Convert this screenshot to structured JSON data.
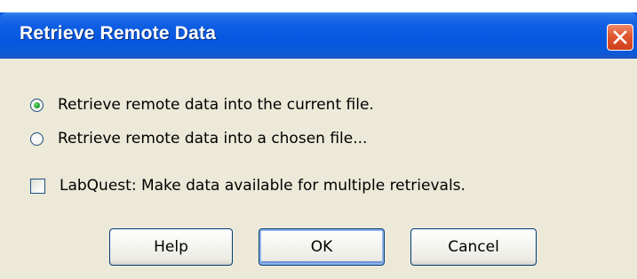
{
  "window": {
    "title": "Retrieve Remote Data"
  },
  "options": {
    "current_file_label": "Retrieve remote data into the current file.",
    "chosen_file_label": "Retrieve remote data into a chosen file...",
    "selected": "current_file",
    "labquest_label": "LabQuest: Make data available for multiple retrievals.",
    "labquest_checked": false
  },
  "buttons": {
    "help_label": "Help",
    "ok_label": "OK",
    "cancel_label": "Cancel"
  },
  "colors": {
    "titlebar": "#0553e0",
    "dialog_bg": "#ece9d8",
    "close_button": "#e05a33",
    "radio_dot": "#1f9a2d",
    "button_border": "#003c74"
  },
  "icons": {
    "close": "close-icon"
  }
}
